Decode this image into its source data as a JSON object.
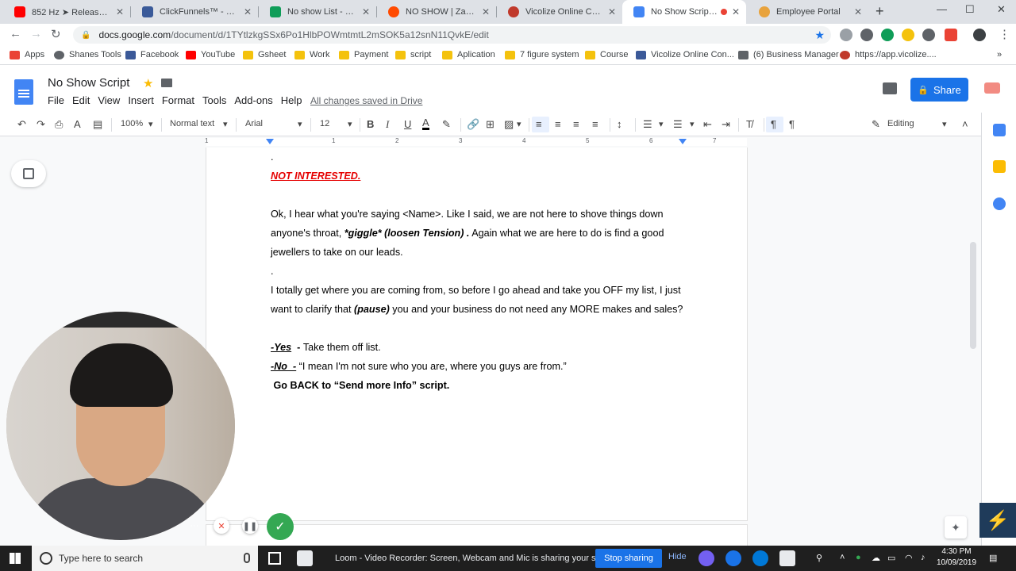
{
  "browser": {
    "tabs": [
      {
        "title": "852 Hz ➤ Release Unc",
        "color": "#ff0000"
      },
      {
        "title": "ClickFunnels™ - Market",
        "color": "#3a5a99"
      },
      {
        "title": "No show List - Google",
        "color": "#0f9d58"
      },
      {
        "title": "NO SHOW | Zapier",
        "color": "#ff4a00"
      },
      {
        "title": "Vicolize Online Consulti",
        "color": "#c0392b"
      },
      {
        "title": "No Show Script - G",
        "color": "#4285f4"
      },
      {
        "title": "Employee Portal",
        "color": "#e8a33d"
      }
    ],
    "new_tab": "+",
    "url_host": "docs.google.com",
    "url_path": "/document/d/1TYtlzkgSSx6Po1HlbPOWmtmtL2mSOK5a12snN11QvkE/edit",
    "bookmarks": [
      {
        "label": "Apps",
        "color": "#ea4335"
      },
      {
        "label": "Shanes Tools",
        "color": "#5f6368"
      },
      {
        "label": "Facebook",
        "color": "#3b5998"
      },
      {
        "label": "YouTube",
        "color": "#ff0000"
      },
      {
        "label": "Gsheet",
        "color": "#f4c20d"
      },
      {
        "label": "Work",
        "color": "#f4c20d"
      },
      {
        "label": "Payment",
        "color": "#f4c20d"
      },
      {
        "label": "script",
        "color": "#f4c20d"
      },
      {
        "label": "Aplication",
        "color": "#f4c20d"
      },
      {
        "label": "7 figure system",
        "color": "#f4c20d"
      },
      {
        "label": "Course",
        "color": "#f4c20d"
      },
      {
        "label": "Vicolize Online Con...",
        "color": "#3b5998"
      },
      {
        "label": "(6) Business Manager",
        "color": "#5f6368"
      },
      {
        "label": "https://app.vicolize....",
        "color": "#c0392b"
      }
    ]
  },
  "docs": {
    "title": "No Show Script",
    "menu": [
      "File",
      "Edit",
      "View",
      "Insert",
      "Format",
      "Tools",
      "Add-ons",
      "Help"
    ],
    "saved_status": "All changes saved in Drive",
    "share_label": "Share",
    "zoom": "100%",
    "style": "Normal text",
    "font": "Arial",
    "font_size": "12",
    "mode": "Editing",
    "ruler_nums": [
      "1",
      "1",
      "2",
      "3",
      "4",
      "5",
      "6",
      "7"
    ]
  },
  "content": {
    "dot1": ".",
    "heading": "NOT INTERESTED.",
    "p1_a": "Ok, I hear what you're saying <Name>. Like I said, we are not here to shove things down anyone's throat, ",
    "p1_b": "*giggle* (loosen Tension) .",
    "p1_c": " Again what we are here to do is find a good jewellers to take on our leads.",
    "dot2": ".",
    "p2_a": "I totally get where you are coming from, so before I go ahead and take you OFF my list, I just want to clarify that ",
    "p2_b": "(pause)",
    "p2_c": " you and your business do not need any MORE makes and sales?",
    "yes_label": "-Yes",
    "yes_dash": "  - ",
    "yes_text": "Take them off list.",
    "no_label": "-No  -",
    "no_text": " “I mean I'm not sure who you are, where you guys are from.”",
    "go_back": " Go BACK to “Send more Info” script."
  },
  "taskbar": {
    "search_placeholder": "Type here to search",
    "loom_message": "Loom - Video Recorder: Screen, Webcam and Mic is sharing your screen.",
    "stop_sharing": "Stop sharing",
    "hide": "Hide",
    "time": "4:30 PM",
    "date": "10/09/2019"
  }
}
